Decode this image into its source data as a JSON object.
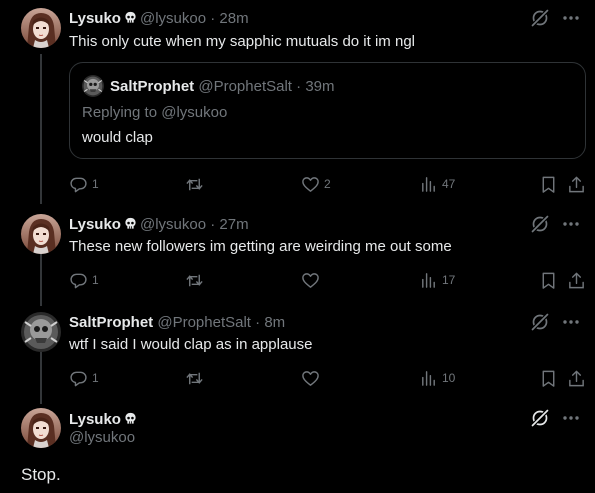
{
  "posts": [
    {
      "name": "Lysuko",
      "handle": "@lysukoo",
      "dot": "·",
      "time": "28m",
      "text": "This only cute when my sapphic mutuals do it im ngl",
      "quote": {
        "name": "SaltProphet",
        "handle": "@ProphetSalt",
        "dot": "·",
        "time": "39m",
        "replying": "Replying to @lysukoo",
        "text": "would clap"
      },
      "replies": "1",
      "retweets": "",
      "likes": "2",
      "views": "47"
    },
    {
      "name": "Lysuko",
      "handle": "@lysukoo",
      "dot": "·",
      "time": "27m",
      "text": "These new followers im getting are weirding me out some",
      "replies": "1",
      "retweets": "",
      "likes": "",
      "views": "17"
    },
    {
      "name": "SaltProphet",
      "handle": "@ProphetSalt",
      "dot": "·",
      "time": "8m",
      "text": "wtf I said I would clap as in applause",
      "replies": "1",
      "retweets": "",
      "likes": "",
      "views": "10"
    }
  ],
  "main_post": {
    "name": "Lysuko",
    "handle": "@lysukoo",
    "text": "Stop."
  },
  "colors": {
    "background": "#000000",
    "text": "#e7e9ea",
    "muted": "#71767b",
    "border": "#2f3336"
  },
  "icons": [
    "grok-icon",
    "more-icon",
    "reply-icon",
    "retweet-icon",
    "like-icon",
    "views-icon",
    "bookmark-icon",
    "share-icon",
    "skull-badge-icon"
  ]
}
